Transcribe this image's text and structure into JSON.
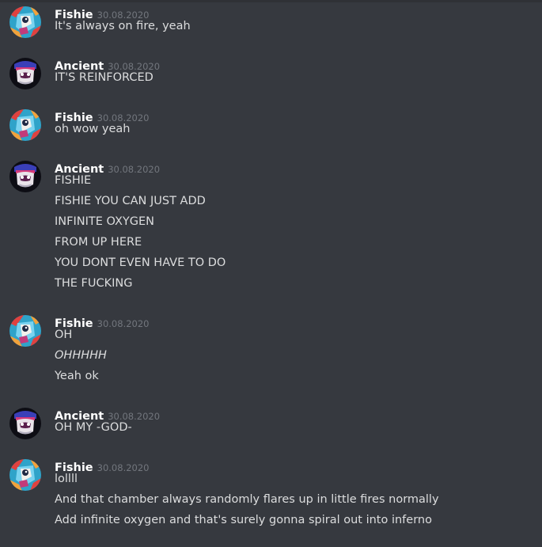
{
  "colors": {
    "background": "#36393f",
    "username": "#ffffff",
    "timestamp": "#72767d",
    "message_text": "#dcddde"
  },
  "messages": [
    {
      "author": "Fishie",
      "avatar_icon": "fishie-avatar-icon",
      "timestamp": "30.08.2020",
      "lines": [
        {
          "text": "It's always on fire, yeah",
          "italic": false
        }
      ]
    },
    {
      "author": "Ancient",
      "avatar_icon": "ancient-avatar-icon",
      "timestamp": "30.08.2020",
      "lines": [
        {
          "text": "IT'S REINFORCED",
          "italic": false
        }
      ]
    },
    {
      "author": "Fishie",
      "avatar_icon": "fishie-avatar-icon",
      "timestamp": "30.08.2020",
      "lines": [
        {
          "text": "oh wow yeah",
          "italic": false
        }
      ]
    },
    {
      "author": "Ancient",
      "avatar_icon": "ancient-avatar-icon",
      "timestamp": "30.08.2020",
      "lines": [
        {
          "text": "FISHIE",
          "italic": false
        },
        {
          "text": "FISHIE YOU CAN JUST ADD",
          "italic": false
        },
        {
          "text": "INFINITE OXYGEN",
          "italic": false
        },
        {
          "text": "FROM UP HERE",
          "italic": false
        },
        {
          "text": "YOU DONT EVEN HAVE TO DO",
          "italic": false
        },
        {
          "text": "THE FUCKING",
          "italic": false
        }
      ]
    },
    {
      "author": "Fishie",
      "avatar_icon": "fishie-avatar-icon",
      "timestamp": "30.08.2020",
      "lines": [
        {
          "text": "OH",
          "italic": false
        },
        {
          "text": "OHHHHH",
          "italic": true
        },
        {
          "text": "Yeah ok",
          "italic": false
        }
      ]
    },
    {
      "author": "Ancient",
      "avatar_icon": "ancient-avatar-icon",
      "timestamp": "30.08.2020",
      "lines": [
        {
          "text": "OH MY -GOD-",
          "italic": false
        }
      ]
    },
    {
      "author": "Fishie",
      "avatar_icon": "fishie-avatar-icon",
      "timestamp": "30.08.2020",
      "lines": [
        {
          "text": "lollll",
          "italic": false
        },
        {
          "text": "And that chamber always randomly flares up in little fires normally",
          "italic": false
        },
        {
          "text": "Add infinite oxygen and that's surely gonna spiral out into inferno",
          "italic": false
        }
      ]
    }
  ]
}
